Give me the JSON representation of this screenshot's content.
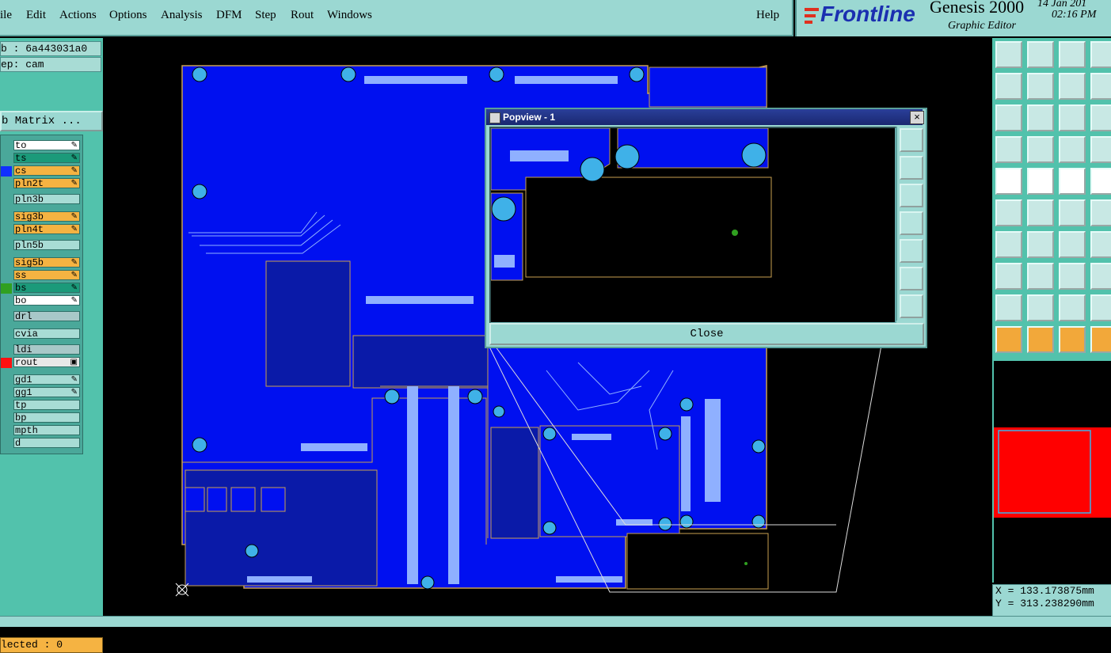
{
  "menu": [
    "ile",
    "Edit",
    "Actions",
    "Options",
    "Analysis",
    "DFM",
    "Step",
    "Rout",
    "Windows"
  ],
  "help": "Help",
  "brand": {
    "logo": "Frontline",
    "title": "Genesis 2000",
    "subtitle": "Graphic Editor",
    "date": "14 Jan 201",
    "time": "02:16 PM"
  },
  "left": {
    "job": "b : 6a443031a0",
    "step": "ep: cam",
    "matrix_button": "b Matrix ...",
    "layers": [
      {
        "name": "to",
        "bg": "#ffffff",
        "swatch": "",
        "tick": "on"
      },
      {
        "name": "ts",
        "bg": "#1b9a7a",
        "swatch": "",
        "tick": "on"
      },
      {
        "name": "cs",
        "bg": "#f5b342",
        "swatch": "#1030ff",
        "tick": "on"
      },
      {
        "name": "pln2t",
        "bg": "#f5b342",
        "swatch": "",
        "tick": "on"
      },
      {
        "name": "pln3b",
        "bg": "#a8dcd5",
        "swatch": "",
        "tick": ""
      },
      {
        "name": "sig3b",
        "bg": "#f5b342",
        "swatch": "",
        "tick": "on"
      },
      {
        "name": "pln4t",
        "bg": "#f5b342",
        "swatch": "",
        "tick": "on"
      },
      {
        "name": "pln5b",
        "bg": "#a8dcd5",
        "swatch": "",
        "tick": ""
      },
      {
        "name": "sig5b",
        "bg": "#f5b342",
        "swatch": "",
        "tick": "on"
      },
      {
        "name": "ss",
        "bg": "#f5b342",
        "swatch": "",
        "tick": "on"
      },
      {
        "name": "bs",
        "bg": "#1b9a7a",
        "swatch": "#30a020",
        "tick": "on"
      },
      {
        "name": "bo",
        "bg": "#ffffff",
        "swatch": "",
        "tick": "on"
      },
      {
        "name": "drl",
        "bg": "#a8c8c8",
        "swatch": "",
        "tick": ""
      },
      {
        "name": "cvia",
        "bg": "#a8dcd5",
        "swatch": "",
        "tick": ""
      },
      {
        "name": "ldi",
        "bg": "#a8c8c8",
        "swatch": "",
        "tick": ""
      },
      {
        "name": "rout",
        "bg": "#e8e8e8",
        "swatch": "#ff1010",
        "tick": "box"
      },
      {
        "name": "gd1",
        "bg": "#a8dcd5",
        "swatch": "",
        "tick": "on"
      },
      {
        "name": "gg1",
        "bg": "#a8dcd5",
        "swatch": "",
        "tick": "on"
      },
      {
        "name": "tp",
        "bg": "#a8dcd5",
        "swatch": "",
        "tick": ""
      },
      {
        "name": "bp",
        "bg": "#a8dcd5",
        "swatch": "",
        "tick": ""
      },
      {
        "name": "mpth",
        "bg": "#a8dcd5",
        "swatch": "",
        "tick": ""
      },
      {
        "name": "d",
        "bg": "#a8dcd5",
        "swatch": "",
        "tick": ""
      }
    ],
    "selected": "lected : 0"
  },
  "popview": {
    "title": "Popview - 1",
    "close_x": "×",
    "close_label": "Close"
  },
  "coords": {
    "x": "X = 133.173875mm",
    "y": "Y = 313.238290mm"
  },
  "colors": {
    "panel": "#9bd8d2",
    "board": "#0000ff",
    "pad": "#3fb1e8",
    "trace_outline": "#c9a050",
    "overview": "#ff0000"
  }
}
